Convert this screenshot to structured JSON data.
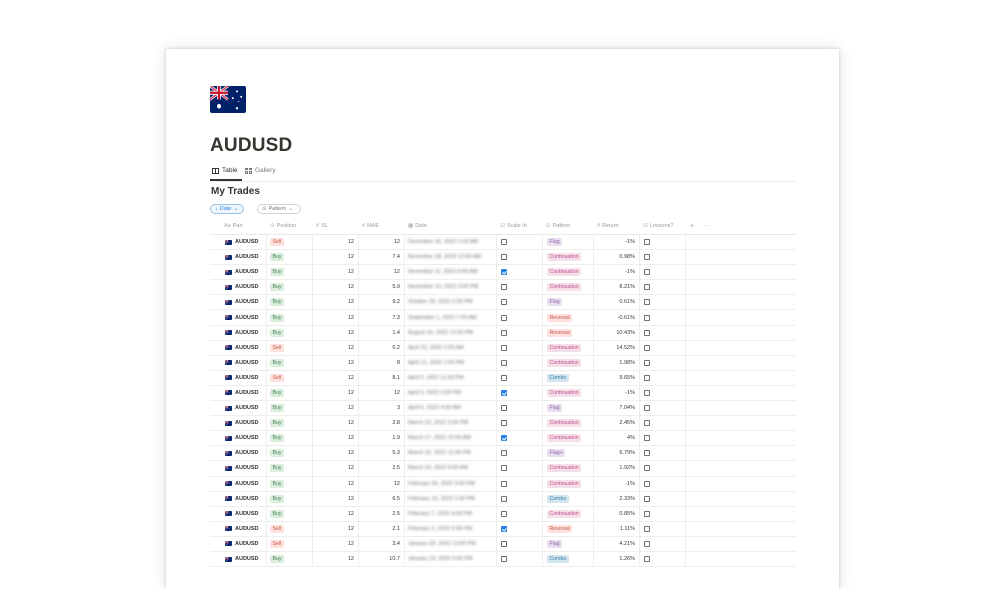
{
  "page": {
    "title": "AUDUSD",
    "icon": "australia-flag-icon"
  },
  "tabs": [
    {
      "label": "Table",
      "icon": "table-icon",
      "active": true
    },
    {
      "label": "Gallery",
      "icon": "gallery-icon",
      "active": false
    }
  ],
  "database": {
    "title": "My Trades"
  },
  "filters": {
    "sort_label": "Date",
    "pattern_label": "Pattern"
  },
  "columns": {
    "pair": "Pair",
    "position": "Position",
    "sl": "SL",
    "mae": "MAE",
    "date": "Date",
    "scale_in": "Scale In",
    "pattern": "Pattern",
    "return": "Return",
    "lessons": "Lessons?",
    "add": "+",
    "more": "···"
  },
  "colors": {
    "sell_bg": "#ffe2dd",
    "buy_bg": "#dbeddb",
    "flag_bg": "#e8deee",
    "continuation_bg": "#f5e0e9",
    "reversal_bg": "#ffe2dd",
    "combo_bg": "#d3e5ef",
    "accent": "#2383e2"
  },
  "rows": [
    {
      "pair": "AUDUSD",
      "position": "Sell",
      "sl": "12",
      "mae": "12",
      "date": "December 16, 2022 1:00 AM",
      "scale_in": false,
      "pattern": "Flag",
      "return": "-1%",
      "lessons": false
    },
    {
      "pair": "AUDUSD",
      "position": "Buy",
      "sl": "12",
      "mae": "7.4",
      "date": "November 28, 2022 12:00 AM",
      "scale_in": false,
      "pattern": "Continuation",
      "return": "0.98%",
      "lessons": false
    },
    {
      "pair": "AUDUSD",
      "position": "Buy",
      "sl": "12",
      "mae": "12",
      "date": "November 11, 2022 9:00 AM",
      "scale_in": true,
      "pattern": "Continuation",
      "return": "-1%",
      "lessons": false
    },
    {
      "pair": "AUDUSD",
      "position": "Buy",
      "sl": "12",
      "mae": "5.9",
      "date": "November 10, 2022 3:00 PM",
      "scale_in": false,
      "pattern": "Continuation",
      "return": "8.21%",
      "lessons": false
    },
    {
      "pair": "AUDUSD",
      "position": "Buy",
      "sl": "12",
      "mae": "9.2",
      "date": "October 26, 2022 2:00 PM",
      "scale_in": false,
      "pattern": "Flag",
      "return": "0.61%",
      "lessons": false
    },
    {
      "pair": "AUDUSD",
      "position": "Buy",
      "sl": "12",
      "mae": "7.3",
      "date": "September 1, 2022 7:00 AM",
      "scale_in": false,
      "pattern": "Reversal",
      "return": "-0.61%",
      "lessons": false
    },
    {
      "pair": "AUDUSD",
      "position": "Buy",
      "sl": "12",
      "mae": "1.4",
      "date": "August 10, 2022 12:00 PM",
      "scale_in": false,
      "pattern": "Reversal",
      "return": "10.43%",
      "lessons": false
    },
    {
      "pair": "AUDUSD",
      "position": "Sell",
      "sl": "12",
      "mae": "0.2",
      "date": "April 22, 2022 1:00 AM",
      "scale_in": false,
      "pattern": "Continuation",
      "return": "14.52%",
      "lessons": false
    },
    {
      "pair": "AUDUSD",
      "position": "Buy",
      "sl": "12",
      "mae": "8",
      "date": "April 12, 2022 1:00 PM",
      "scale_in": false,
      "pattern": "Continuation",
      "return": "1.98%",
      "lessons": false
    },
    {
      "pair": "AUDUSD",
      "position": "Sell",
      "sl": "12",
      "mae": "8.1",
      "date": "April 5, 2022 11:00 PM",
      "scale_in": false,
      "pattern": "Combo",
      "return": "9.65%",
      "lessons": false
    },
    {
      "pair": "AUDUSD",
      "position": "Buy",
      "sl": "12",
      "mae": "12",
      "date": "April 5, 2022 3:00 PM",
      "scale_in": true,
      "pattern": "Continuation",
      "return": "-1%",
      "lessons": false
    },
    {
      "pair": "AUDUSD",
      "position": "Buy",
      "sl": "12",
      "mae": "3",
      "date": "April 5, 2022 4:00 AM",
      "scale_in": false,
      "pattern": "Flag",
      "return": "7.04%",
      "lessons": false
    },
    {
      "pair": "AUDUSD",
      "position": "Buy",
      "sl": "12",
      "mae": "2.8",
      "date": "March 22, 2022 3:00 PM",
      "scale_in": false,
      "pattern": "Continuation",
      "return": "2.45%",
      "lessons": false
    },
    {
      "pair": "AUDUSD",
      "position": "Buy",
      "sl": "12",
      "mae": "1.9",
      "date": "March 17, 2022 10:00 AM",
      "scale_in": true,
      "pattern": "Continuation",
      "return": "4%",
      "lessons": false
    },
    {
      "pair": "AUDUSD",
      "position": "Buy",
      "sl": "12",
      "mae": "5.3",
      "date": "March 16, 2022 11:00 PM",
      "scale_in": false,
      "pattern": "Flag+",
      "return": "6.79%",
      "lessons": false
    },
    {
      "pair": "AUDUSD",
      "position": "Buy",
      "sl": "12",
      "mae": "2.5",
      "date": "March 10, 2022 8:00 AM",
      "scale_in": false,
      "pattern": "Continuation",
      "return": "1.92%",
      "lessons": false
    },
    {
      "pair": "AUDUSD",
      "position": "Buy",
      "sl": "12",
      "mae": "12",
      "date": "February 25, 2022 3:00 PM",
      "scale_in": false,
      "pattern": "Continuation",
      "return": "-1%",
      "lessons": false
    },
    {
      "pair": "AUDUSD",
      "position": "Buy",
      "sl": "12",
      "mae": "6.5",
      "date": "February 16, 2022 1:00 PM",
      "scale_in": false,
      "pattern": "Combo",
      "return": "2.33%",
      "lessons": false
    },
    {
      "pair": "AUDUSD",
      "position": "Buy",
      "sl": "12",
      "mae": "2.5",
      "date": "February 7, 2022 4:00 PM",
      "scale_in": false,
      "pattern": "Continuation",
      "return": "0.85%",
      "lessons": false
    },
    {
      "pair": "AUDUSD",
      "position": "Sell",
      "sl": "12",
      "mae": "2.1",
      "date": "February 2, 2022 3:00 PM",
      "scale_in": true,
      "pattern": "Reversal",
      "return": "1.11%",
      "lessons": false
    },
    {
      "pair": "AUDUSD",
      "position": "Sell",
      "sl": "12",
      "mae": "3.4",
      "date": "January 29, 2022 12:00 PM",
      "scale_in": false,
      "pattern": "Flag",
      "return": "4.21%",
      "lessons": false
    },
    {
      "pair": "AUDUSD",
      "position": "Buy",
      "sl": "12",
      "mae": "10.7",
      "date": "January 19, 2022 9:00 PM",
      "scale_in": false,
      "pattern": "Combo",
      "return": "1.26%",
      "lessons": false
    }
  ]
}
